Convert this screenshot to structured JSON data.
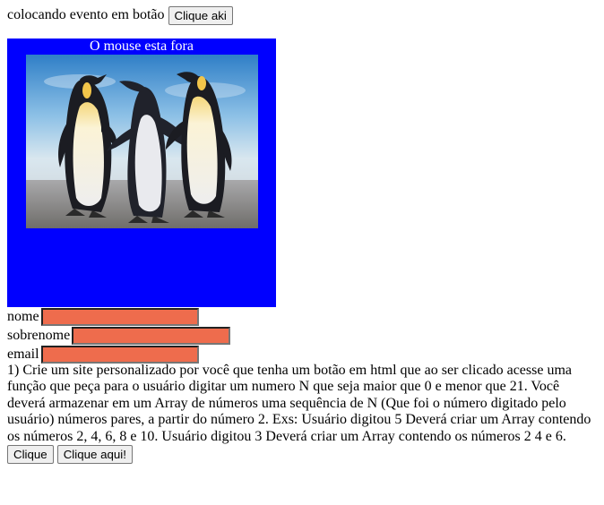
{
  "top": {
    "caption": "colocando evento em botão",
    "button_label": "Clique aki"
  },
  "mouse_box": {
    "status_text": "O mouse esta fora",
    "background_color": "#0000ff",
    "image_subject": "penguins"
  },
  "form": {
    "fields": [
      {
        "label": "nome",
        "value": ""
      },
      {
        "label": "sobrenome",
        "value": ""
      },
      {
        "label": "email",
        "value": ""
      }
    ],
    "input_color": "#ee6c4d"
  },
  "exercise_text": "1) Crie um site personalizado por você que tenha um botão em html que ao ser clicado acesse uma função que peça para o usuário digitar um numero N que seja maior que 0 e menor que 21. Você deverá armazenar em um Array de números uma sequência de N (Que foi o número digitado pelo usuário) números pares, a partir do número 2. Exs: Usuário digitou 5 Deverá criar um Array contendo os números 2, 4, 6, 8 e 10. Usuário digitou 3 Deverá criar um Array contendo os números 2 4 e 6.",
  "bottom_buttons": {
    "clique_label": "Clique",
    "clique_aqui_label": "Clique aqui!"
  }
}
